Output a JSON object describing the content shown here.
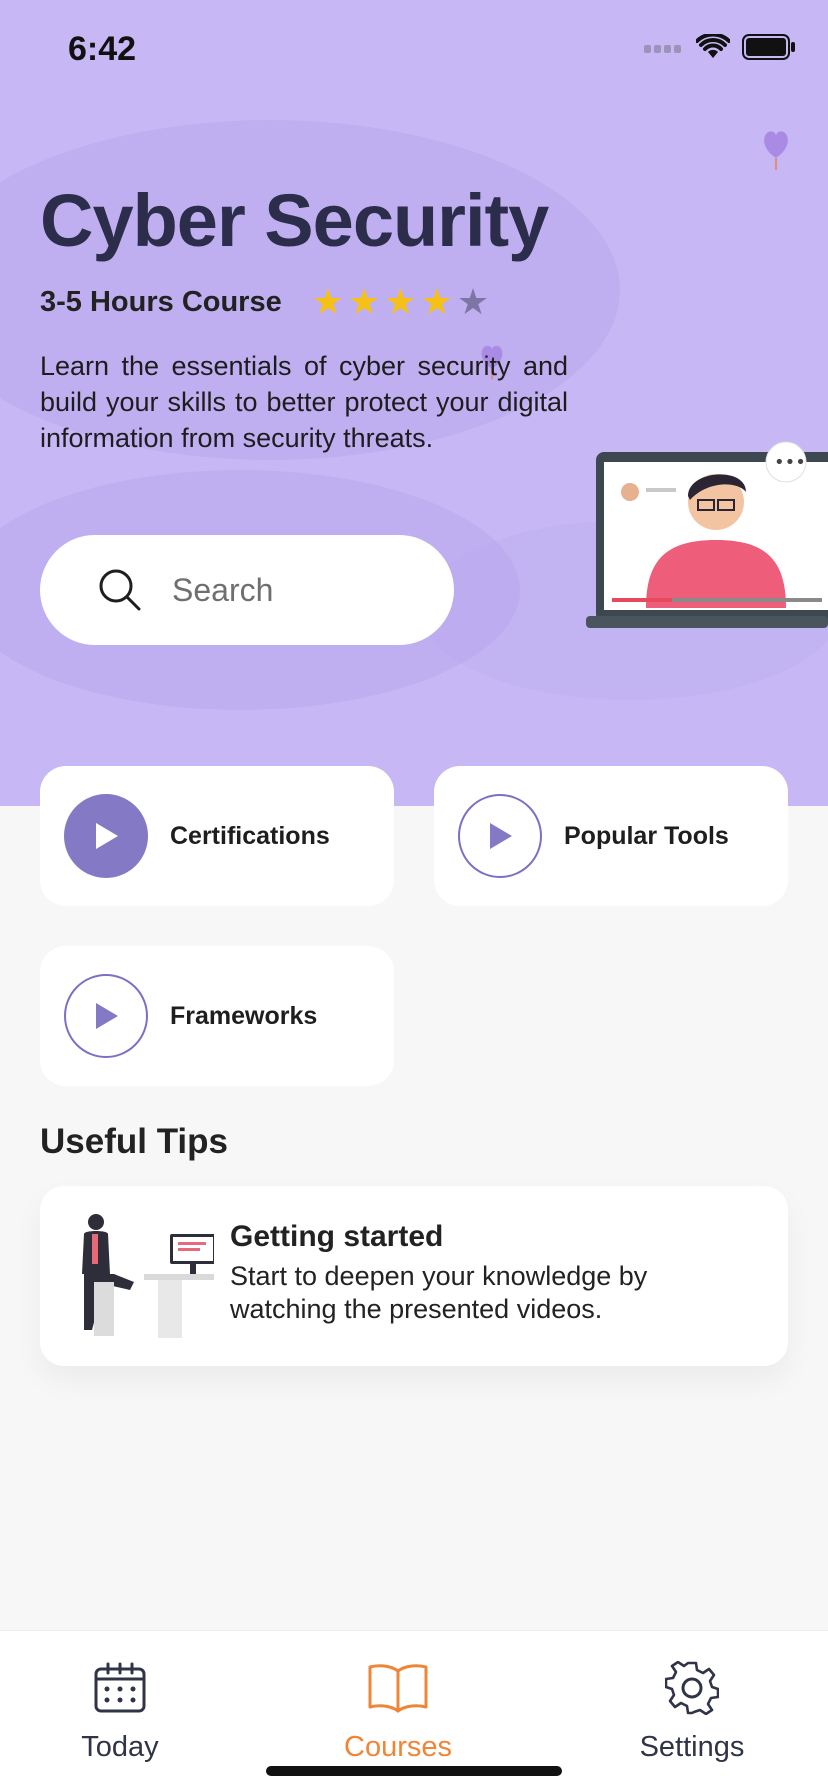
{
  "status_bar": {
    "time": "6:42"
  },
  "hero": {
    "title": "Cyber Security",
    "duration": "3-5 Hours Course",
    "rating": {
      "value": 4,
      "max": 5
    },
    "description": "Learn the essentials of cyber security and build your skills to better protect your digital information from security threats.",
    "colors": {
      "background": "#c7b8f5",
      "title": "#2b2d4a",
      "star_on": "#f5c116",
      "star_off": "#7f75a5"
    }
  },
  "search": {
    "placeholder": "Search"
  },
  "categories": [
    {
      "label": "Certifications",
      "icon": "play-icon",
      "style": "filled"
    },
    {
      "label": "Popular Tools",
      "icon": "play-icon",
      "style": "outline"
    },
    {
      "label": "Frameworks",
      "icon": "play-icon",
      "style": "outline"
    }
  ],
  "tips": {
    "section_title": "Useful Tips",
    "items": [
      {
        "title": "Getting started",
        "body": "Start to deepen your knowledge by watching the presented videos."
      }
    ]
  },
  "tabbar": {
    "items": [
      {
        "label": "Today",
        "icon": "calendar-icon",
        "active": false
      },
      {
        "label": "Courses",
        "icon": "book-icon",
        "active": true
      },
      {
        "label": "Settings",
        "icon": "gear-icon",
        "active": false
      }
    ],
    "active_color": "#ef8537"
  }
}
